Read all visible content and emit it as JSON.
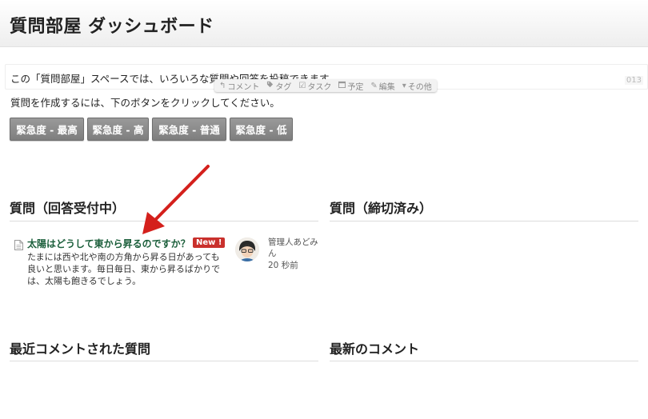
{
  "header": {
    "title": "質問部屋 ダッシュボード"
  },
  "intro": {
    "text": "この「質問部屋」スペースでは、いろいろな質問や回答を投稿できます。",
    "line_number": "013"
  },
  "toolbar": {
    "items": [
      {
        "icon": "reply-icon",
        "label": "コメント"
      },
      {
        "icon": "tag-icon",
        "label": "タグ"
      },
      {
        "icon": "checkbox-icon",
        "label": "タスク"
      },
      {
        "icon": "calendar-icon",
        "label": "予定"
      },
      {
        "icon": "pencil-icon",
        "label": "編集"
      },
      {
        "icon": "caret-down-icon",
        "label": "その他"
      }
    ]
  },
  "instruction": "質問を作成するには、下のボタンをクリックしてください。",
  "buttons": [
    {
      "label": "緊急度 - 最高"
    },
    {
      "label": "緊急度 - 高"
    },
    {
      "label": "緊急度 - 普通"
    },
    {
      "label": "緊急度 - 低"
    }
  ],
  "sections": {
    "open_questions": "質問（回答受付中）",
    "closed_questions": "質問（締切済み）",
    "recent_commented": "最近コメントされた質問",
    "latest_comments": "最新のコメント"
  },
  "question": {
    "title": "太陽はどうして東から昇るのですか？",
    "badge": "New !",
    "body": "たまには西や北や南の方角から昇る日があっても良いと思います。毎日毎日、東から昇るばかりでは、太陽も飽きるでしょう。",
    "author": "管理人あどみん",
    "time": "20 秒前"
  },
  "colors": {
    "title_green": "#1a5e3a",
    "badge_red": "#c9302c",
    "arrow_red": "#d4201c",
    "button_gray": "#8a8a8a"
  }
}
